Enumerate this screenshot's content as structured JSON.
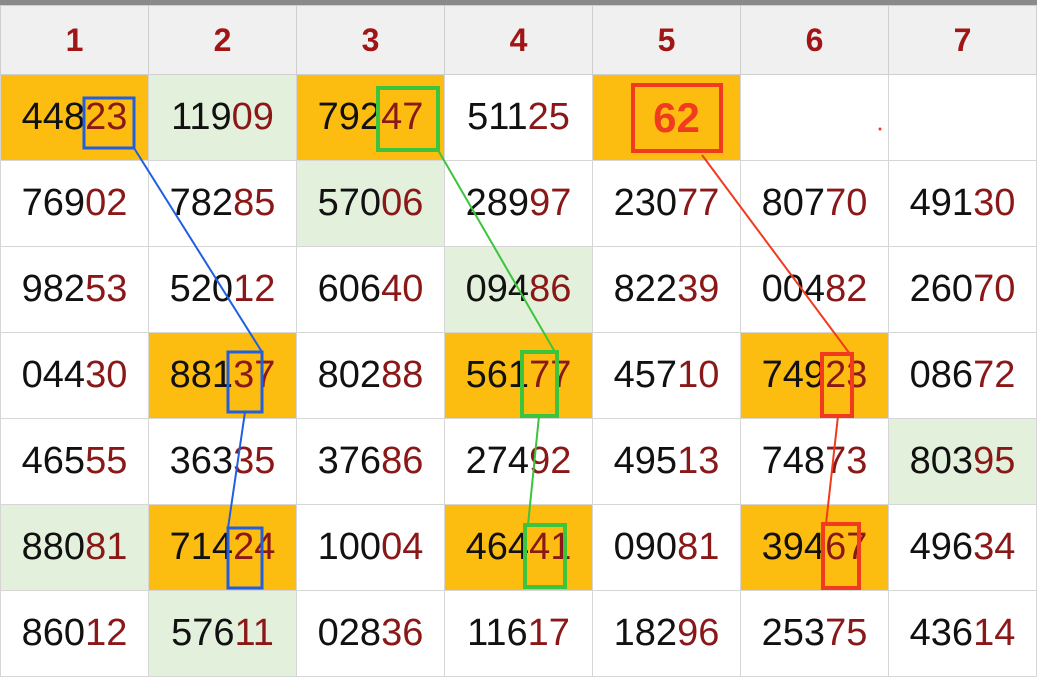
{
  "headers": [
    "1",
    "2",
    "3",
    "4",
    "5",
    "6",
    "7"
  ],
  "rows": [
    [
      {
        "a": "448",
        "b": "23",
        "bg": "orange"
      },
      {
        "a": "119",
        "b": "09",
        "bg": "green"
      },
      {
        "a": "792",
        "b": "47",
        "bg": "orange"
      },
      {
        "a": "511",
        "b": "25",
        "bg": "white"
      },
      {
        "a": "",
        "b": "62",
        "bg": "orange",
        "special": true
      },
      {
        "a": "",
        "b": "",
        "bg": "white"
      },
      {
        "a": "",
        "b": "",
        "bg": "white"
      }
    ],
    [
      {
        "a": "769",
        "b": "02",
        "bg": "white"
      },
      {
        "a": "782",
        "b": "85",
        "bg": "white"
      },
      {
        "a": "570",
        "b": "06",
        "bg": "green"
      },
      {
        "a": "289",
        "b": "97",
        "bg": "white"
      },
      {
        "a": "230",
        "b": "77",
        "bg": "white"
      },
      {
        "a": "807",
        "b": "70",
        "bg": "white"
      },
      {
        "a": "491",
        "b": "30",
        "bg": "white"
      }
    ],
    [
      {
        "a": "982",
        "b": "53",
        "bg": "white"
      },
      {
        "a": "520",
        "b": "12",
        "bg": "white"
      },
      {
        "a": "606",
        "b": "40",
        "bg": "white"
      },
      {
        "a": "094",
        "b": "86",
        "bg": "green"
      },
      {
        "a": "822",
        "b": "39",
        "bg": "white"
      },
      {
        "a": "004",
        "b": "82",
        "bg": "white"
      },
      {
        "a": "260",
        "b": "70",
        "bg": "white"
      }
    ],
    [
      {
        "a": "044",
        "b": "30",
        "bg": "white"
      },
      {
        "a": "881",
        "b": "37",
        "bg": "orange"
      },
      {
        "a": "802",
        "b": "88",
        "bg": "white"
      },
      {
        "a": "561",
        "b": "77",
        "bg": "orange"
      },
      {
        "a": "457",
        "b": "10",
        "bg": "white"
      },
      {
        "a": "749",
        "b": "23",
        "bg": "orange"
      },
      {
        "a": "086",
        "b": "72",
        "bg": "white"
      }
    ],
    [
      {
        "a": "465",
        "b": "55",
        "bg": "white"
      },
      {
        "a": "363",
        "b": "35",
        "bg": "white"
      },
      {
        "a": "376",
        "b": "86",
        "bg": "white"
      },
      {
        "a": "274",
        "b": "92",
        "bg": "white"
      },
      {
        "a": "495",
        "b": "13",
        "bg": "white"
      },
      {
        "a": "748",
        "b": "73",
        "bg": "white"
      },
      {
        "a": "803",
        "b": "95",
        "bg": "green"
      }
    ],
    [
      {
        "a": "880",
        "b": "81",
        "bg": "green"
      },
      {
        "a": "714",
        "b": "24",
        "bg": "orange"
      },
      {
        "a": "100",
        "b": "04",
        "bg": "white"
      },
      {
        "a": "464",
        "b": "41",
        "bg": "orange"
      },
      {
        "a": "090",
        "b": "81",
        "bg": "white"
      },
      {
        "a": "394",
        "b": "67",
        "bg": "orange"
      },
      {
        "a": "496",
        "b": "34",
        "bg": "white"
      }
    ],
    [
      {
        "a": "860",
        "b": "12",
        "bg": "white"
      },
      {
        "a": "576",
        "b": "11",
        "bg": "green"
      },
      {
        "a": "028",
        "b": "36",
        "bg": "white"
      },
      {
        "a": "116",
        "b": "17",
        "bg": "white"
      },
      {
        "a": "182",
        "b": "96",
        "bg": "white"
      },
      {
        "a": "253",
        "b": "75",
        "bg": "white"
      },
      {
        "a": "436",
        "b": "14",
        "bg": "white"
      }
    ]
  ],
  "colors": {
    "orange_cell": "#fdbd10",
    "green_cell": "#e3f0dc",
    "header_text": "#a01616",
    "pair_digits": "#8a1818",
    "blue_line": "#1f5fe0",
    "green_line": "#3cc43c",
    "red_line": "#f03b1e"
  }
}
